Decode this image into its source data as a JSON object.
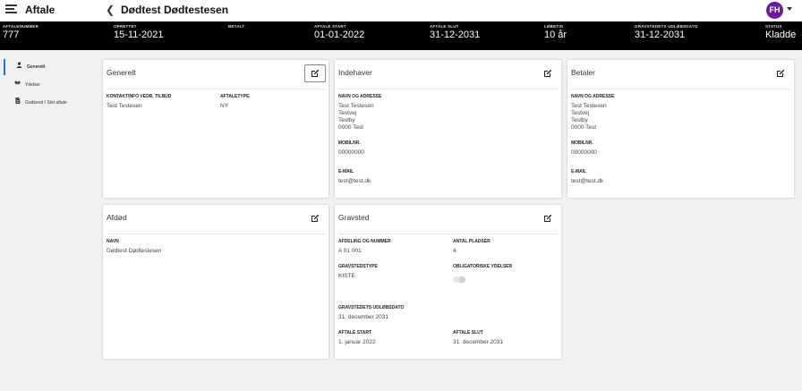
{
  "header": {
    "app_title": "Aftale",
    "page_title": "Dødtest Dødtestesen",
    "avatar_initials": "FH",
    "avatar_color": "#6a1b9a"
  },
  "infobar": {
    "items": [
      {
        "label": "AFTALENUMMER",
        "value": "777"
      },
      {
        "label": "OPRETTET",
        "value": "15-11-2021"
      },
      {
        "label": "BETALT",
        "value": ""
      },
      {
        "label": "AFTALE START",
        "value": "01-01-2022"
      },
      {
        "label": "AFTALE SLUT",
        "value": "31-12-2031"
      },
      {
        "label": "LØBETID",
        "value": "10 år"
      },
      {
        "label": "GRAVSTEDETS UDLØBSDATO",
        "value": "31-12-2031"
      },
      {
        "label": "STATUS",
        "value": "Kladde"
      }
    ]
  },
  "sidebar": {
    "items": [
      {
        "label": "Generelt",
        "icon": "person-icon"
      },
      {
        "label": "Ydelser",
        "icon": "handshake-icon"
      },
      {
        "label": "Godkend / Slet aftale",
        "icon": "document-icon"
      }
    ]
  },
  "cards": {
    "generelt": {
      "title": "Generelt",
      "contact_label": "KONTAKTINFO VEDR. TILBUD",
      "contact_value": "Test Testesen",
      "type_label": "AFTALETYPE",
      "type_value": "NY"
    },
    "indehaver": {
      "title": "Indehaver",
      "address_label": "NAVN OG ADRESSE",
      "address_lines": [
        "Test Testesen",
        "Testvej",
        "Testby",
        "0000 Test"
      ],
      "mobile_label": "MOBILNR.",
      "mobile_value": "00000000",
      "email_label": "E-MAIL",
      "email_value": "test@test.dk"
    },
    "betaler": {
      "title": "Betaler",
      "address_label": "NAVN OG ADRESSE",
      "address_lines": [
        "Test Testesen",
        "Testvej",
        "Testby",
        "0000 Test"
      ],
      "mobile_label": "MOBILNR.",
      "mobile_value": "00000000",
      "email_label": "E-MAIL",
      "email_value": "test@test.dk"
    },
    "afdod": {
      "title": "Afdød",
      "name_label": "NAVN",
      "name_value": "Dødtest Dødtestesen"
    },
    "gravsted": {
      "title": "Gravsted",
      "afdeling_label": "AFDELING OG NUMMER",
      "afdeling_value": "A 01 001",
      "pladser_label": "ANTAL PLADSER",
      "pladser_value": "4",
      "type_label": "GRAVSTEDSTYPE",
      "type_value": "KISTE",
      "obligatoriske_label": "OBLIGATORISKE YDELSER",
      "obligatoriske_on": false,
      "udlob_label": "GRAVSTEDETS UDLØBSDATO",
      "udlob_value": "31. december 2031",
      "start_label": "AFTALE START",
      "start_value": "1. januar 2022",
      "slut_label": "AFTALE SLUT",
      "slut_value": "31. december 2031"
    }
  }
}
